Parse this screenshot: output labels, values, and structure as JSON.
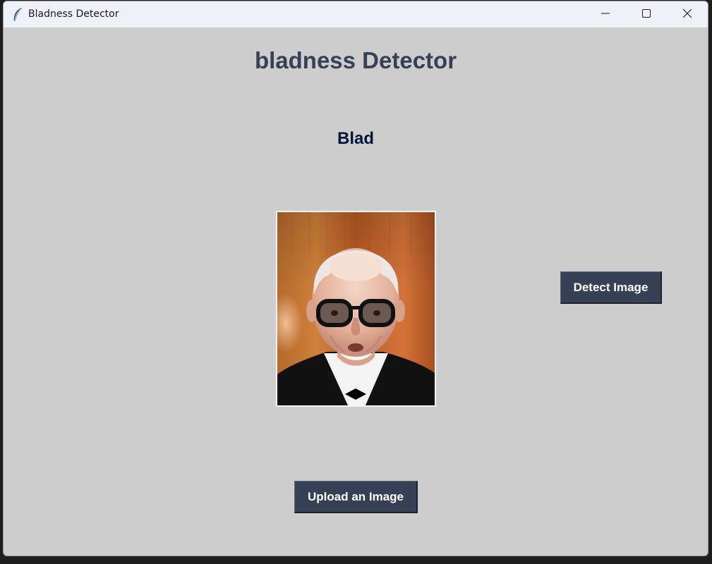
{
  "window": {
    "title": "Bladness Detector",
    "icon": "feather-icon"
  },
  "controls": {
    "minimize": "minimize-icon",
    "maximize": "maximize-icon",
    "close": "close-icon"
  },
  "main": {
    "heading": "bladness Detector",
    "result": "Blad",
    "detect_button": "Detect Image",
    "upload_button": "Upload an Image"
  },
  "colors": {
    "background": "#cdcdcd",
    "heading": "#364156",
    "result": "#011638",
    "button_bg": "#364156",
    "button_text": "#ffffff"
  }
}
